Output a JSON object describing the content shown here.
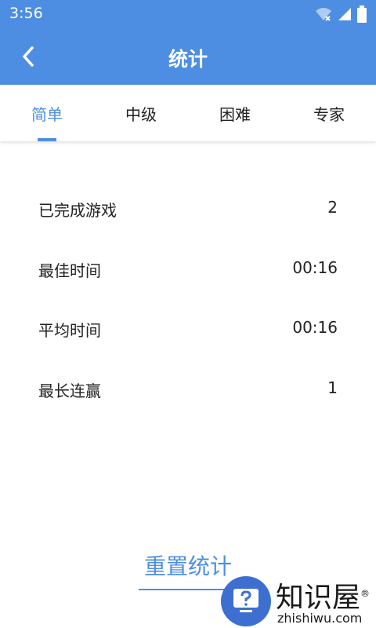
{
  "status": {
    "time": "3:56"
  },
  "header": {
    "title": "统计"
  },
  "tabs": [
    {
      "label": "简单"
    },
    {
      "label": "中级"
    },
    {
      "label": "困难"
    },
    {
      "label": "专家"
    }
  ],
  "stats": [
    {
      "label": "已完成游戏",
      "value": "2"
    },
    {
      "label": "最佳时间",
      "value": "00:16"
    },
    {
      "label": "平均时间",
      "value": "00:16"
    },
    {
      "label": "最长连赢",
      "value": "1"
    }
  ],
  "reset": {
    "label": "重置统计"
  },
  "watermark": {
    "title": "知识屋",
    "registered": "®",
    "site": "zhishiwu.com"
  },
  "colors": {
    "accent": "#4d8ee3",
    "watermark_blue": "#3d6fd0"
  }
}
